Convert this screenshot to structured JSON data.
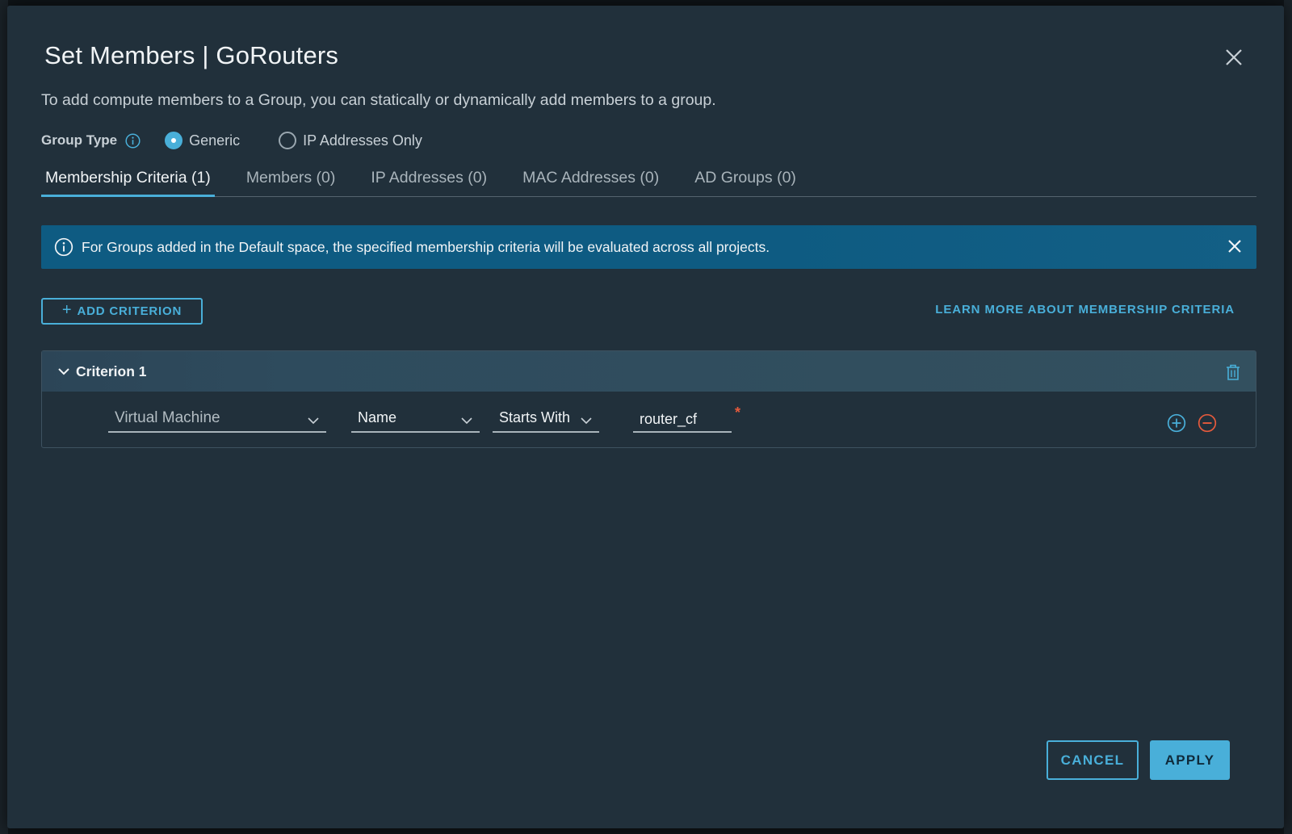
{
  "modal": {
    "title": "Set Members | GoRouters",
    "description": "To add compute members to a Group, you can statically or dynamically add members to a group."
  },
  "group_type": {
    "label": "Group Type",
    "options": [
      {
        "label": "Generic",
        "selected": true
      },
      {
        "label": "IP Addresses Only",
        "selected": false
      }
    ]
  },
  "tabs": [
    {
      "label": "Membership Criteria (1)",
      "active": true
    },
    {
      "label": "Members (0)",
      "active": false
    },
    {
      "label": "IP Addresses (0)",
      "active": false
    },
    {
      "label": "MAC Addresses (0)",
      "active": false
    },
    {
      "label": "AD Groups (0)",
      "active": false
    }
  ],
  "alert": {
    "text": "For Groups added in the Default space, the specified membership criteria will be evaluated across all projects."
  },
  "actions": {
    "add_criterion": "ADD CRITERION",
    "learn_more": "LEARN MORE ABOUT MEMBERSHIP CRITERIA"
  },
  "criterion": {
    "title": "Criterion 1",
    "member_type": "Virtual Machine",
    "attribute": "Name",
    "operator": "Starts With",
    "value": "router_cf",
    "required_marker": "*"
  },
  "footer": {
    "cancel": "CANCEL",
    "apply": "APPLY"
  },
  "colors": {
    "accent": "#49afd9",
    "modal_bg": "#21303b",
    "alert_bg": "#0e5b82",
    "danger": "#e55a3c"
  }
}
